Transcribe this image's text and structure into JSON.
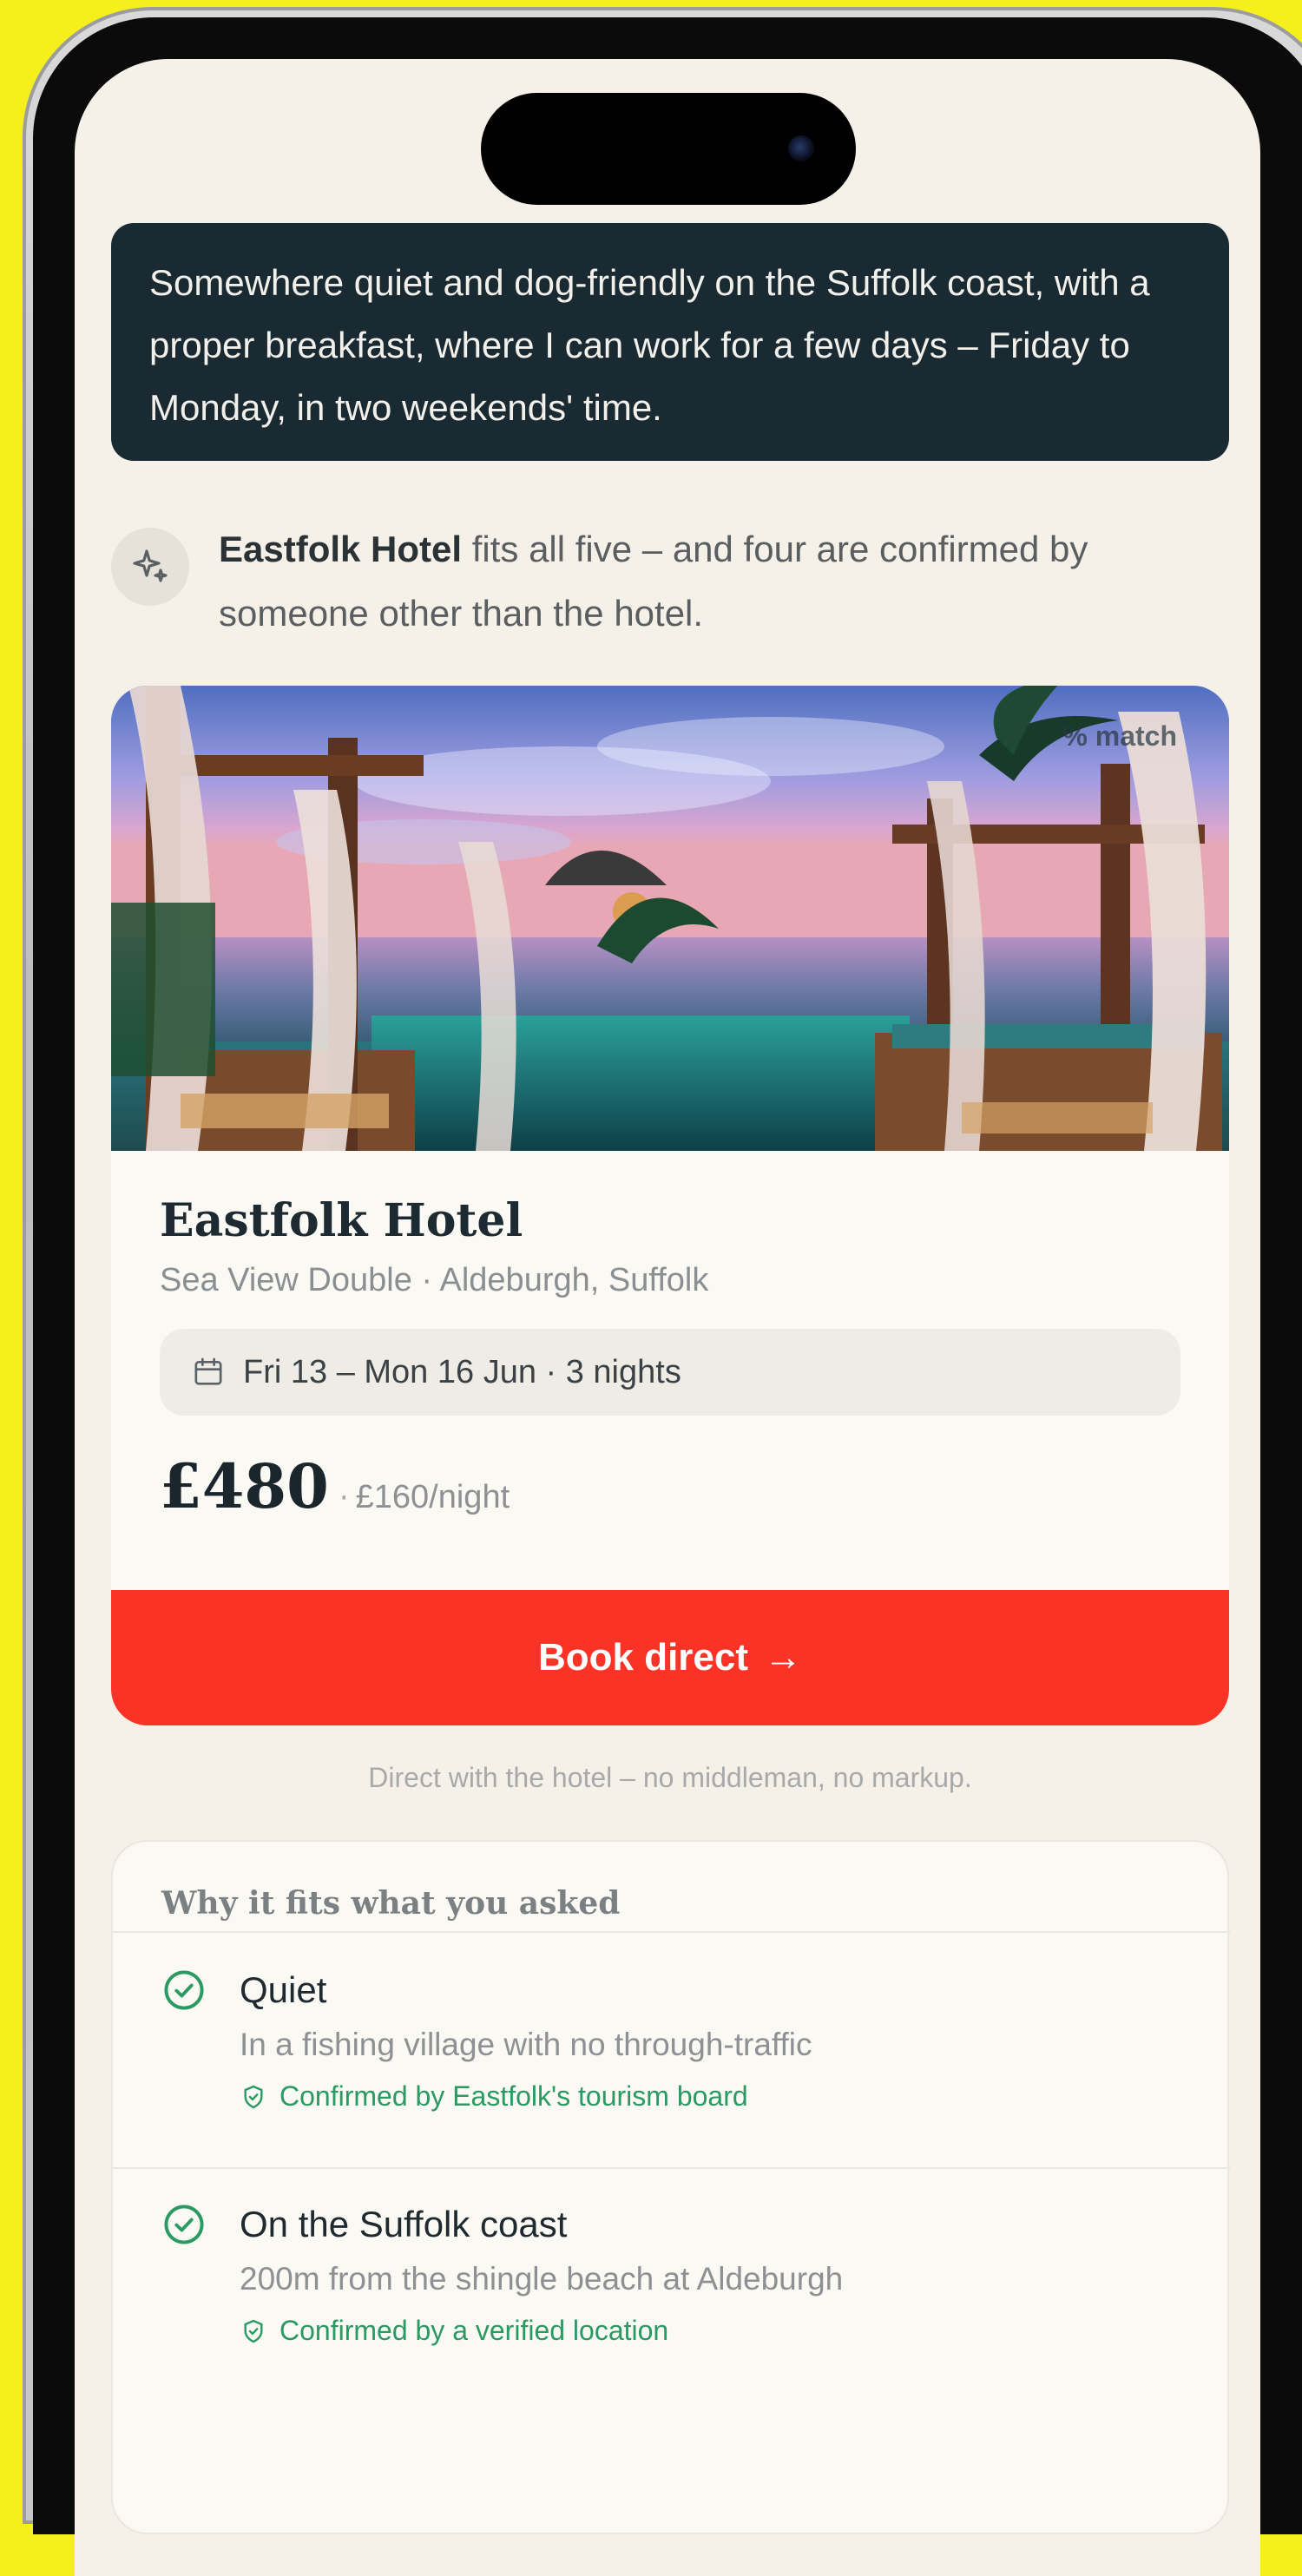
{
  "prompt": {
    "text": "Somewhere quiet and dog-friendly on the Suffolk coast, with a proper breakfast, where I can work for a few days – Friday to Monday, in two weekends' time."
  },
  "assistant": {
    "hotel_name_bold": "Eastfolk Hotel",
    "message_rest": " fits all five – and four are confirmed by someone other than the hotel."
  },
  "hotel": {
    "match_badge": "% match",
    "name": "Eastfolk Hotel",
    "subtitle": "Sea View Double · Aldeburgh, Suffolk",
    "dates": "Fri 13 – Mon 16 Jun · 3 nights",
    "price_total": "£480",
    "price_separator": "·",
    "price_per_night": "£160/night",
    "book_label": "Book direct",
    "book_arrow": "→"
  },
  "footnote": "Direct with the hotel – no middleman, no markup.",
  "why": {
    "title": "Why it fits what you asked",
    "items": [
      {
        "title": "Quiet",
        "detail": "In a fishing village with no through-traffic",
        "confirmation": "Confirmed by Eastfolk's tourism board"
      },
      {
        "title": "On the Suffolk coast",
        "detail": "200m from the shingle beach at Aldeburgh",
        "confirmation": "Confirmed by a verified location"
      }
    ]
  },
  "colors": {
    "background": "#f5ef1c",
    "screen": "#f5f1e8",
    "prompt_bubble": "#1a2a33",
    "book_button": "#fb3226",
    "confirm_green": "#2a9a62"
  },
  "icons": {
    "assistant": "sparkle-icon",
    "dates": "calendar-icon",
    "fit": "check-circle-icon",
    "confirm": "shield-check-icon"
  }
}
